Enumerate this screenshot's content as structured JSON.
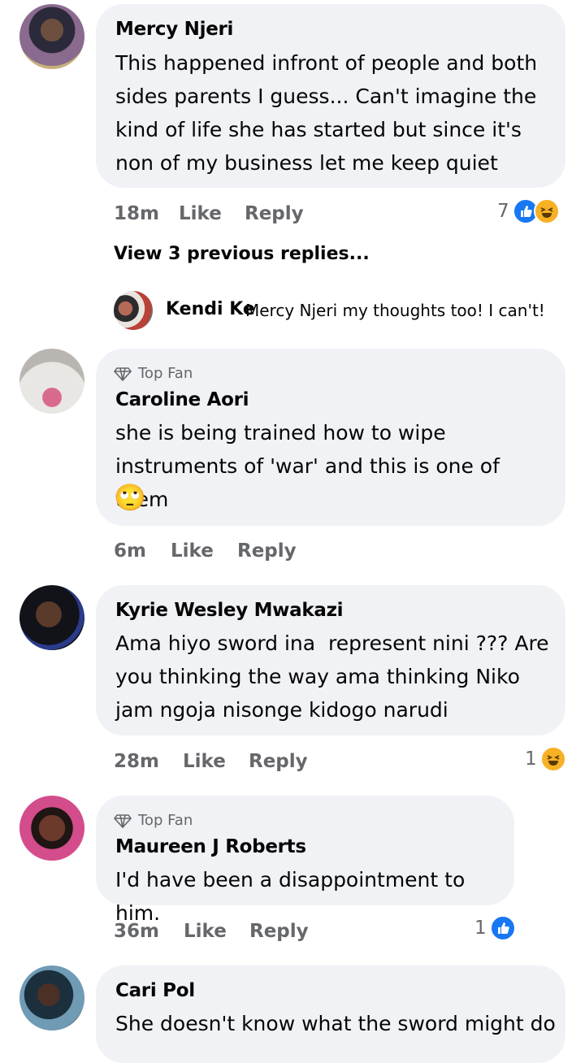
{
  "comments": [
    {
      "name": "Mercy Njeri",
      "text": "This happened infront of people and both\nsides parents I guess... Can't imagine the\nkind of life she has started but since it's\nnon of my business let me keep quiet",
      "time": "18m",
      "like_label": "Like",
      "reply_label": "Reply",
      "reaction_count": "7",
      "reactions": [
        "like-icon",
        "haha-icon"
      ],
      "avatar_color": "#4a3a4c"
    },
    {
      "badge": "Top Fan",
      "name": "Caroline Aori",
      "text": "she is being trained how to wipe\ninstruments of 'war' and this is one of them",
      "emoji": "🙄",
      "time": "6m",
      "like_label": "Like",
      "reply_label": "Reply",
      "avatar_color": "#c9c6c2"
    },
    {
      "name": "Kyrie Wesley Mwakazi",
      "text": "Ama hiyo sword ina  represent nini ??? Are\nyou thinking the way ama thinking Niko\njam ngoja nisonge kidogo narudi",
      "time": "28m",
      "like_label": "Like",
      "reply_label": "Reply",
      "reaction_count": "1",
      "reactions": [
        "haha-icon"
      ],
      "avatar_color": "#1a1a24"
    },
    {
      "badge": "Top Fan",
      "name": "Maureen J Roberts",
      "text": "I'd have been a disappointment to him.",
      "time": "36m",
      "like_label": "Like",
      "reply_label": "Reply",
      "reaction_count": "1",
      "reactions": [
        "like-icon"
      ],
      "avatar_color": "#d25a8a"
    },
    {
      "name": "Cari Pol",
      "text": "She doesn't know what the sword might do",
      "avatar_color": "#3b5f7a"
    }
  ],
  "thread": {
    "view_previous": "View 3 previous replies...",
    "reply": {
      "name": "Kendi Ke",
      "text": "Mercy Njeri my thoughts too! I can't!"
    }
  },
  "colors": {
    "bubble": "#f0f2f5",
    "meta": "#65676b",
    "like_blue": "#1877f2",
    "haha_yellow": "#f7b125"
  }
}
